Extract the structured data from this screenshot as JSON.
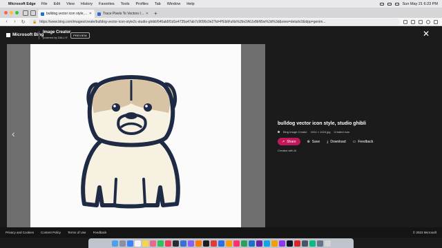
{
  "menubar": {
    "apple_glyph": "",
    "app_name": "Microsoft Edge",
    "items": [
      "File",
      "Edit",
      "View",
      "History",
      "Favorites",
      "Tools",
      "Profiles",
      "Tab",
      "Window",
      "Help"
    ],
    "clock": "Sun May 21  6:23 PM"
  },
  "tabs": [
    {
      "title": "bulldog vector icon style, studio ghibli",
      "favicon_color": "#1a73c7",
      "active": true
    },
    {
      "title": "Trace Pixels To Vectors In Full Color",
      "favicon_color": "#2b6bd6",
      "active": false
    }
  ],
  "browser": {
    "url": "https://www.bing.com/images/create/bulldog-vector-icon-style2c-studio-ghibli/646ab5f1d1e4735a47ab7c9096c0e2?id=PEbliFuNs%2bv2A0Jv8bN5w%3d%3d&view=detailv2&idpp=genim...",
    "new_tab_glyph": "+"
  },
  "viewer": {
    "brand": "Microsoft Bing",
    "product": "Image Creator",
    "powered_by": "powered by DALL·E",
    "badge": "PREVIEW",
    "close_glyph": "✕",
    "prev_glyph": "‹"
  },
  "image_info": {
    "prompt": "bulldog vector icon style, studio ghibli",
    "source": "Bing Image Creator",
    "dimensions": "1024 × 1024 jpg",
    "created": "Created now",
    "created_with": "Created with AI"
  },
  "actions": {
    "share": "Share",
    "save": "Save",
    "download": "Download",
    "feedback": "Feedback"
  },
  "footer": {
    "links": [
      "Privacy and Cookies",
      "Content Policy",
      "Terms of Use",
      "Feedback"
    ],
    "copyright": "© 2023 Microsoft"
  },
  "colors": {
    "share_accent": "#c2185b",
    "dog_outline": "#1f2a44",
    "dog_tan": "#d9c3a5",
    "dog_cream": "#f6f1e1"
  },
  "dock": {
    "apps": [
      {
        "name": "finder",
        "color": "#4aa3e8"
      },
      {
        "name": "launchpad",
        "color": "#8a8fa3"
      },
      {
        "name": "mail",
        "color": "#3b82f6"
      },
      {
        "name": "calendar",
        "color": "#f4f4f4"
      },
      {
        "name": "notes",
        "color": "#f6d54a"
      },
      {
        "name": "photos",
        "color": "#e96a8a"
      },
      {
        "name": "facetime",
        "color": "#35c159"
      },
      {
        "name": "music",
        "color": "#f03b5a"
      },
      {
        "name": "app",
        "color": "#2c2c2c"
      },
      {
        "name": "app",
        "color": "#3a6fd8"
      },
      {
        "name": "app",
        "color": "#8b5cf6"
      },
      {
        "name": "app",
        "color": "#ff7a00"
      },
      {
        "name": "app",
        "color": "#1e1e1e"
      },
      {
        "name": "app",
        "color": "#e23a3a"
      },
      {
        "name": "app",
        "color": "#2f6fe4"
      },
      {
        "name": "app",
        "color": "#ff9a00"
      },
      {
        "name": "app",
        "color": "#ff3366"
      },
      {
        "name": "app",
        "color": "#2e9e5b"
      },
      {
        "name": "app",
        "color": "#1a73c7"
      },
      {
        "name": "app",
        "color": "#6b21a8"
      },
      {
        "name": "app",
        "color": "#0ea5e9"
      },
      {
        "name": "app",
        "color": "#f59e0b"
      },
      {
        "name": "app",
        "color": "#9333ea"
      },
      {
        "name": "app",
        "color": "#0f172a"
      },
      {
        "name": "app",
        "color": "#dc2626"
      },
      {
        "name": "app",
        "color": "#4b5563"
      },
      {
        "name": "app",
        "color": "#10b981"
      },
      {
        "name": "app",
        "color": "#64748b"
      },
      {
        "name": "trash",
        "color": "#d4d4d8"
      }
    ]
  }
}
